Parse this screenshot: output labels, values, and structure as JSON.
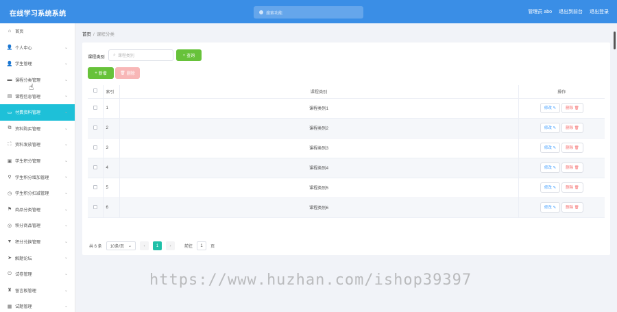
{
  "header": {
    "title": "在线学习系统系统",
    "search_placeholder": "搜索功能",
    "links": [
      "管理员 abo",
      "退出到前台",
      "退出登录"
    ]
  },
  "sidebar": {
    "items": [
      {
        "label": "首页",
        "icon": "home-icon",
        "chevron": false
      },
      {
        "label": "个人中心",
        "icon": "user-icon",
        "chevron": true
      },
      {
        "label": "学生管理",
        "icon": "user-icon",
        "chevron": true
      },
      {
        "label": "课程分类管理",
        "icon": "chat-icon",
        "chevron": true
      },
      {
        "label": "课程信息管理",
        "icon": "book-icon",
        "chevron": true
      },
      {
        "label": "付费资料管理",
        "icon": "file-icon",
        "chevron": true,
        "active": true
      },
      {
        "label": "资料购买管理",
        "icon": "copy-icon",
        "chevron": true
      },
      {
        "label": "资料发放管理",
        "icon": "frame-icon",
        "chevron": true
      },
      {
        "label": "学生积分管理",
        "icon": "id-card-icon",
        "chevron": true
      },
      {
        "label": "学生积分增加管理",
        "icon": "pin-icon",
        "chevron": true
      },
      {
        "label": "学生积分扣减管理",
        "icon": "clock-icon",
        "chevron": true
      },
      {
        "label": "商品分类管理",
        "icon": "flag-icon",
        "chevron": true
      },
      {
        "label": "积分商品管理",
        "icon": "gift-icon",
        "chevron": true
      },
      {
        "label": "积分兑换管理",
        "icon": "filter-icon",
        "chevron": true
      },
      {
        "label": "解题论坛",
        "icon": "send-icon",
        "chevron": true
      },
      {
        "label": "试卷管理",
        "icon": "power-icon",
        "chevron": true
      },
      {
        "label": "留言板管理",
        "icon": "bell-icon",
        "chevron": true
      },
      {
        "label": "试题管理",
        "icon": "grid-icon",
        "chevron": true
      }
    ]
  },
  "breadcrumb": {
    "home": "首页",
    "current": "课程分类"
  },
  "filter": {
    "label": "课程类别",
    "placeholder": "课程类别",
    "query_label": "查询"
  },
  "actions": {
    "add_label": "新增",
    "delete_label": "删除"
  },
  "table": {
    "headers": {
      "index": "索引",
      "name": "课程类别",
      "ops": "操作"
    },
    "rows": [
      {
        "index": "1",
        "name": "课程类别1"
      },
      {
        "index": "2",
        "name": "课程类别2"
      },
      {
        "index": "3",
        "name": "课程类别3"
      },
      {
        "index": "4",
        "name": "课程类别4"
      },
      {
        "index": "5",
        "name": "课程类别5"
      },
      {
        "index": "6",
        "name": "课程类别6"
      }
    ],
    "edit_label": "修改",
    "remove_label": "删除"
  },
  "pagination": {
    "total": "共 6 条",
    "page_size": "10条/页",
    "current_page": "1",
    "goto_prefix": "前往",
    "goto_value": "1",
    "goto_suffix": "页"
  },
  "watermark": "https://www.huzhan.com/ishop39397",
  "colors": {
    "header": "#3a8ee6",
    "active": "#1ec0d8",
    "success": "#67c23a",
    "danger_light": "#f8b7b7"
  }
}
